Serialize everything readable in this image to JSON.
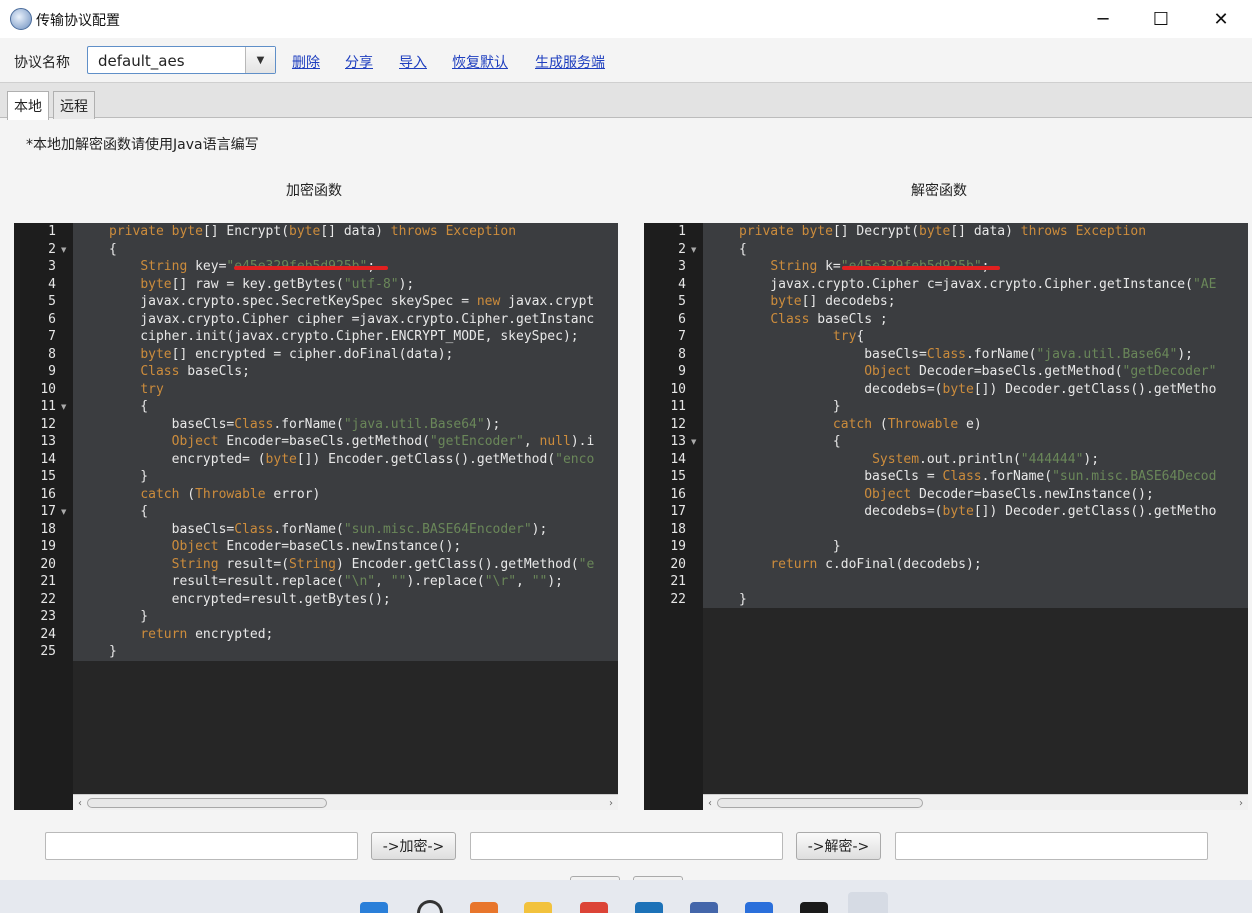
{
  "window": {
    "title": "传输协议配置",
    "minimize": "─",
    "maximize": "☐",
    "close": "✕"
  },
  "toolbar": {
    "protocol_label": "协议名称",
    "protocol_value": "default_aes",
    "combo_arrow": "▼",
    "links": [
      "删除",
      "分享",
      "导入",
      "恢复默认",
      "生成服务端"
    ]
  },
  "tabs": [
    "本地",
    "远程"
  ],
  "note": "*本地加解密函数请使用Java语言编写",
  "encrypt": {
    "title": "加密函数",
    "lines": [
      [
        [
          "kw",
          "private "
        ],
        [
          "kw",
          "byte"
        ],
        [
          "t",
          "[] Encrypt("
        ],
        [
          "kw",
          "byte"
        ],
        [
          "t",
          "[] data) "
        ],
        [
          "kw",
          "throws Exception"
        ]
      ],
      [
        [
          "t",
          "{"
        ]
      ],
      [
        [
          "t",
          "    "
        ],
        [
          "kw",
          "String"
        ],
        [
          "t",
          " key="
        ],
        [
          "str",
          "\"e45e329feb5d925b\""
        ],
        [
          "t",
          ";"
        ]
      ],
      [
        [
          "t",
          "    "
        ],
        [
          "kw",
          "byte"
        ],
        [
          "t",
          "[] raw = key.getBytes("
        ],
        [
          "str",
          "\"utf-8\""
        ],
        [
          "t",
          ");"
        ]
      ],
      [
        [
          "t",
          "    javax.crypto.spec.SecretKeySpec skeySpec = "
        ],
        [
          "kw",
          "new"
        ],
        [
          "t",
          " javax.crypt"
        ]
      ],
      [
        [
          "t",
          "    javax.crypto.Cipher cipher =javax.crypto.Cipher.getInstanc"
        ]
      ],
      [
        [
          "t",
          "    cipher.init(javax.crypto.Cipher.ENCRYPT_MODE, skeySpec);"
        ]
      ],
      [
        [
          "t",
          "    "
        ],
        [
          "kw",
          "byte"
        ],
        [
          "t",
          "[] encrypted = cipher.doFinal(data);"
        ]
      ],
      [
        [
          "t",
          "    "
        ],
        [
          "kw",
          "Class"
        ],
        [
          "t",
          " baseCls;"
        ]
      ],
      [
        [
          "t",
          "    "
        ],
        [
          "kw",
          "try"
        ]
      ],
      [
        [
          "t",
          "    {"
        ]
      ],
      [
        [
          "t",
          "        baseCls="
        ],
        [
          "kw",
          "Class"
        ],
        [
          "t",
          ".forName("
        ],
        [
          "str",
          "\"java.util.Base64\""
        ],
        [
          "t",
          ");"
        ]
      ],
      [
        [
          "t",
          "        "
        ],
        [
          "kw",
          "Object"
        ],
        [
          "t",
          " Encoder=baseCls.getMethod("
        ],
        [
          "str",
          "\"getEncoder\""
        ],
        [
          "t",
          ", "
        ],
        [
          "kw",
          "null"
        ],
        [
          "t",
          ").i"
        ]
      ],
      [
        [
          "t",
          "        encrypted= ("
        ],
        [
          "kw",
          "byte"
        ],
        [
          "t",
          "[]) Encoder.getClass().getMethod("
        ],
        [
          "str",
          "\"enco"
        ]
      ],
      [
        [
          "t",
          "    }"
        ]
      ],
      [
        [
          "t",
          "    "
        ],
        [
          "kw",
          "catch"
        ],
        [
          "t",
          " ("
        ],
        [
          "kw",
          "Throwable"
        ],
        [
          "t",
          " error)"
        ]
      ],
      [
        [
          "t",
          "    {"
        ]
      ],
      [
        [
          "t",
          "        baseCls="
        ],
        [
          "kw",
          "Class"
        ],
        [
          "t",
          ".forName("
        ],
        [
          "str",
          "\"sun.misc.BASE64Encoder\""
        ],
        [
          "t",
          ");"
        ]
      ],
      [
        [
          "t",
          "        "
        ],
        [
          "kw",
          "Object"
        ],
        [
          "t",
          " Encoder=baseCls.newInstance();"
        ]
      ],
      [
        [
          "t",
          "        "
        ],
        [
          "kw",
          "String"
        ],
        [
          "t",
          " result=("
        ],
        [
          "kw",
          "String"
        ],
        [
          "t",
          ") Encoder.getClass().getMethod("
        ],
        [
          "str",
          "\"e"
        ]
      ],
      [
        [
          "t",
          "        result=result.replace("
        ],
        [
          "str",
          "\"\\n\""
        ],
        [
          "t",
          ", "
        ],
        [
          "str",
          "\"\""
        ],
        [
          "t",
          ").replace("
        ],
        [
          "str",
          "\"\\r\""
        ],
        [
          "t",
          ", "
        ],
        [
          "str",
          "\"\""
        ],
        [
          "t",
          ");"
        ]
      ],
      [
        [
          "t",
          "        encrypted=result.getBytes();"
        ]
      ],
      [
        [
          "t",
          "    }"
        ]
      ],
      [
        [
          "t",
          "    "
        ],
        [
          "kw",
          "return"
        ],
        [
          "t",
          " encrypted;"
        ]
      ],
      [
        [
          "t",
          "}"
        ]
      ]
    ]
  },
  "decrypt": {
    "title": "解密函数",
    "lines": [
      [
        [
          "kw",
          "private "
        ],
        [
          "kw",
          "byte"
        ],
        [
          "t",
          "[] Decrypt("
        ],
        [
          "kw",
          "byte"
        ],
        [
          "t",
          "[] data) "
        ],
        [
          "kw",
          "throws Exception"
        ]
      ],
      [
        [
          "t",
          "{"
        ]
      ],
      [
        [
          "t",
          "    "
        ],
        [
          "kw",
          "String"
        ],
        [
          "t",
          " k="
        ],
        [
          "str",
          "\"e45e329feb5d925b\""
        ],
        [
          "t",
          ";"
        ]
      ],
      [
        [
          "t",
          "    javax.crypto.Cipher c=javax.crypto.Cipher.getInstance("
        ],
        [
          "str",
          "\"AE"
        ]
      ],
      [
        [
          "t",
          "    "
        ],
        [
          "kw",
          "byte"
        ],
        [
          "t",
          "[] decodebs;"
        ]
      ],
      [
        [
          "t",
          "    "
        ],
        [
          "kw",
          "Class"
        ],
        [
          "t",
          " baseCls ;"
        ]
      ],
      [
        [
          "t",
          "            "
        ],
        [
          "kw",
          "try"
        ],
        [
          "t",
          "{"
        ]
      ],
      [
        [
          "t",
          "                baseCls="
        ],
        [
          "kw",
          "Class"
        ],
        [
          "t",
          ".forName("
        ],
        [
          "str",
          "\"java.util.Base64\""
        ],
        [
          "t",
          ");"
        ]
      ],
      [
        [
          "t",
          "                "
        ],
        [
          "kw",
          "Object"
        ],
        [
          "t",
          " Decoder=baseCls.getMethod("
        ],
        [
          "str",
          "\"getDecoder\""
        ]
      ],
      [
        [
          "t",
          "                decodebs=("
        ],
        [
          "kw",
          "byte"
        ],
        [
          "t",
          "[]) Decoder.getClass().getMetho"
        ]
      ],
      [
        [
          "t",
          "            }"
        ]
      ],
      [
        [
          "t",
          "            "
        ],
        [
          "kw",
          "catch"
        ],
        [
          "t",
          " ("
        ],
        [
          "kw",
          "Throwable"
        ],
        [
          "t",
          " e)"
        ]
      ],
      [
        [
          "t",
          "            {"
        ]
      ],
      [
        [
          "t",
          "                 "
        ],
        [
          "kw",
          "System"
        ],
        [
          "t",
          ".out.println("
        ],
        [
          "str",
          "\"444444\""
        ],
        [
          "t",
          ");"
        ]
      ],
      [
        [
          "t",
          "                baseCls = "
        ],
        [
          "kw",
          "Class"
        ],
        [
          "t",
          ".forName("
        ],
        [
          "str",
          "\"sun.misc.BASE64Decod"
        ]
      ],
      [
        [
          "t",
          "                "
        ],
        [
          "kw",
          "Object"
        ],
        [
          "t",
          " Decoder=baseCls.newInstance();"
        ]
      ],
      [
        [
          "t",
          "                decodebs=("
        ],
        [
          "kw",
          "byte"
        ],
        [
          "t",
          "[]) Decoder.getClass().getMetho"
        ]
      ],
      [
        [
          "t",
          ""
        ]
      ],
      [
        [
          "t",
          "            }"
        ]
      ],
      [
        [
          "t",
          "    "
        ],
        [
          "kw",
          "return"
        ],
        [
          "t",
          " c.doFinal(decodebs);"
        ]
      ],
      [
        [
          "t",
          ""
        ]
      ],
      [
        [
          "t",
          "}"
        ]
      ]
    ]
  },
  "bottom": {
    "encrypt_button": "->加密->",
    "decrypt_button": "->解密->"
  }
}
